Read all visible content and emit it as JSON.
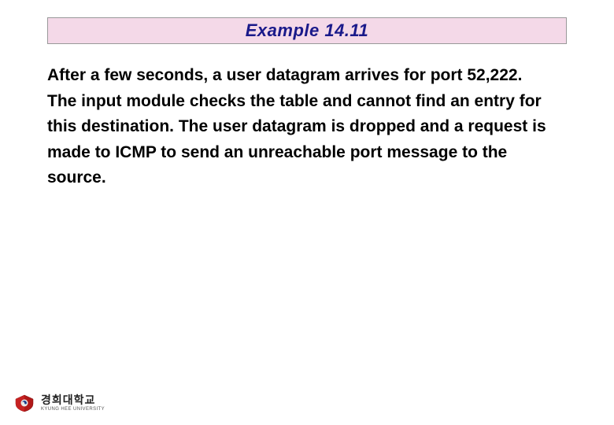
{
  "title": "Example 14.11",
  "body": "After a few seconds, a user datagram arrives for port 52,222. The input module checks the table and cannot find an entry for this destination. The user datagram is dropped and a request is made to ICMP to send an unreachable port message to the source.",
  "logo": {
    "name_kr": "경희대학교",
    "name_en": "KYUNG HEE UNIVERSITY"
  }
}
